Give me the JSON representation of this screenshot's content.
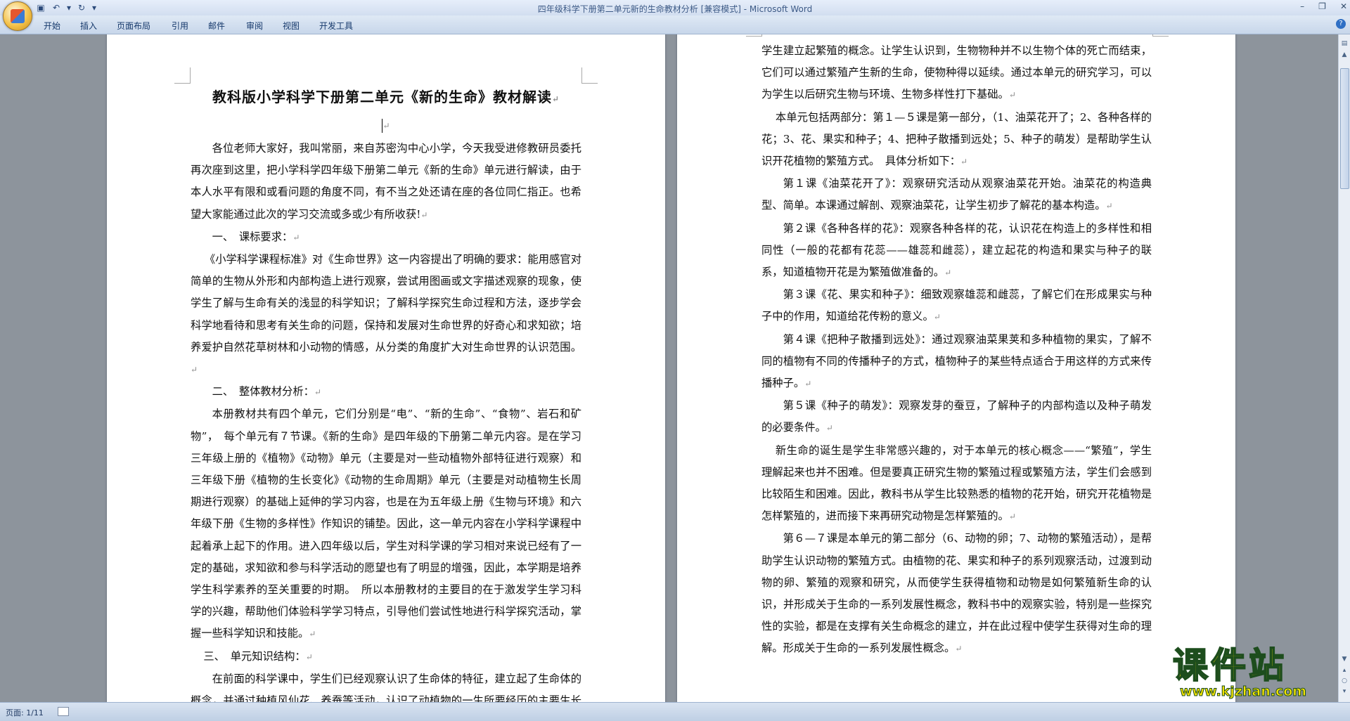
{
  "window": {
    "title_doc": "四年级科学下册第二单元新的生命教材分析 [兼容模式] - ",
    "title_app": "Microsoft Word",
    "controls": [
      "–",
      "❐",
      "✕"
    ]
  },
  "ribbon": {
    "tabs": [
      "开始",
      "插入",
      "页面布局",
      "引用",
      "邮件",
      "审阅",
      "视图",
      "开发工具"
    ]
  },
  "status": {
    "page_count": "页面: 1/11"
  },
  "watermark": {
    "chinese": "课件站",
    "url": "www.kjzhan.com"
  },
  "page1": {
    "title": "教科版小学科学下册第二单元《新的生命》教材解读",
    "paragraphs": [
      "各位老师大家好，我叫常丽，来自苏密沟中心小学，今天我受进修教研员委托再次座到这里，把小学科学四年级下册第二单元《新的生命》单元进行解读，由于本人水平有限和或看问题的角度不同，有不当之处还请在座的各位同仁指正。也希望大家能通过此次的学习交流或多或少有所收获!",
      "一、　课标要求：",
      "《小学科学课程标准》对《生命世界》这一内容提出了明确的要求：能用感官对简单的生物从外形和内部构造上进行观察，尝试用图画或文字描述观察的现象，使学生了解与生命有关的浅显的科学知识；了解科学探究生命过程和方法，逐步学会科学地看待和思考有关生命的问题，保持和发展对生命世界的好奇心和求知欲；培养爱护自然花草树林和小动物的情感，从分类的角度扩大对生命世界的认识范围。",
      "二、　整体教材分析：",
      "本册教材共有四个单元，它们分别是“电”、“新的生命”、“食物”、岩石和矿物”，　每个单元有７节课。《新的生命》是四年级的下册第二单元内容。是在学习三年级上册的《植物》《动物》单元（主要是对一些动植物外部特征进行观察）和三年级下册《植物的生长变化》《动物的生命周期》单元（主要是对动植物生长周期进行观察）的基础上延伸的学习内容，也是在为五年级上册《生物与环境》和六年级下册《生物的多样性》作知识的铺垫。因此，这一单元内容在小学科学课程中起着承上起下的作用。进入四年级以后，学生对科学课的学习相对来说已经有了一定的基础，求知欲和参与科学活动的愿望也有了明显的增强，因此，本学期是培养学生科学素养的至关重要的时期。　所以本册教材的主要目的在于激发学生学习科学的兴趣，帮助他们体验科学学习特点，引导他们尝试性地进行科学探究活动，掌握一些科学知识和技能。",
      "三、　单元知识结构：",
      "在前面的科学课中，学生们已经观察认识了生命体的特征，建立起了生命体的概念，并通过种植风仙花、养蚕等活动，认识了动植物的一生所要经历的主要生长过程及其变化，建立起了生命周期的概念。在此基础上，本单元试图帮助"
    ]
  },
  "page2": {
    "paragraphs": [
      "学生建立起繁殖的概念。让学生认识到，生物物种并不以生物个体的死亡而结束，它们可以通过繁殖产生新的生命，使物种得以延续。通过本单元的研究学习，可以为学生以后研究生物与环境、生物多样性打下基础。",
      "本单元包括两部分：第１—５课是第一部分，（1、油菜花开了；2、各种各样的花；3、花、果实和种子；4、把种子散播到远处；5、种子的萌发）是帮助学生认识开花植物的繁殖方式。　具体分析如下：",
      "第１课《油菜花开了》：观察研究活动从观察油菜花开始。油菜花的构造典型、简单。本课通过解剖、观察油菜花，让学生初步了解花的基本构造。",
      "第２课《各种各样的花》：观察各种各样的花，认识花在构造上的多样性和相同性（一般的花都有花蕊——雄蕊和雌蕊），建立起花的构造和果实与种子的联系，知道植物开花是为繁殖做准备的。",
      "第３课《花、果实和种子》：细致观察雄蕊和雌蕊，了解它们在形成果实与种子中的作用，知道给花传粉的意义。",
      "第４课《把种子散播到远处》：通过观察油菜果荚和多种植物的果实，了解不同的植物有不同的传播种子的方式，植物种子的某些特点适合于用这样的方式来传播种子。",
      "第５课《种子的萌发》：观察发芽的蚕豆，了解种子的内部构造以及种子萌发的必要条件。",
      "新生命的诞生是学生非常感兴趣的，对于本单元的核心概念——“繁殖”，学生理解起来也并不困难。但是要真正研究生物的繁殖过程或繁殖方法，学生们会感到比较陌生和困难。因此，教科书从学生比较熟悉的植物的花开始，研究开花植物是怎样繁殖的，进而接下来再研究动物是怎样繁殖的。",
      "第６—７课是本单元的第二部分（6、动物的卵；7、动物的繁殖活动），是帮助学生认识动物的繁殖方式。由植物的花、果实和种子的系列观察活动，过渡到动物的卵、繁殖的观察和研究，从而使学生获得植物和动物是如何繁殖新生命的认识，并形成关于生命的一系列发展性概念，教科书中的观察实验，特别是一些探究性的实验，都是在支撑有关生命概念的建立，并在此过程中使学生获得对生命的理解。形成关于生命的一系列发展性概念。"
    ]
  }
}
